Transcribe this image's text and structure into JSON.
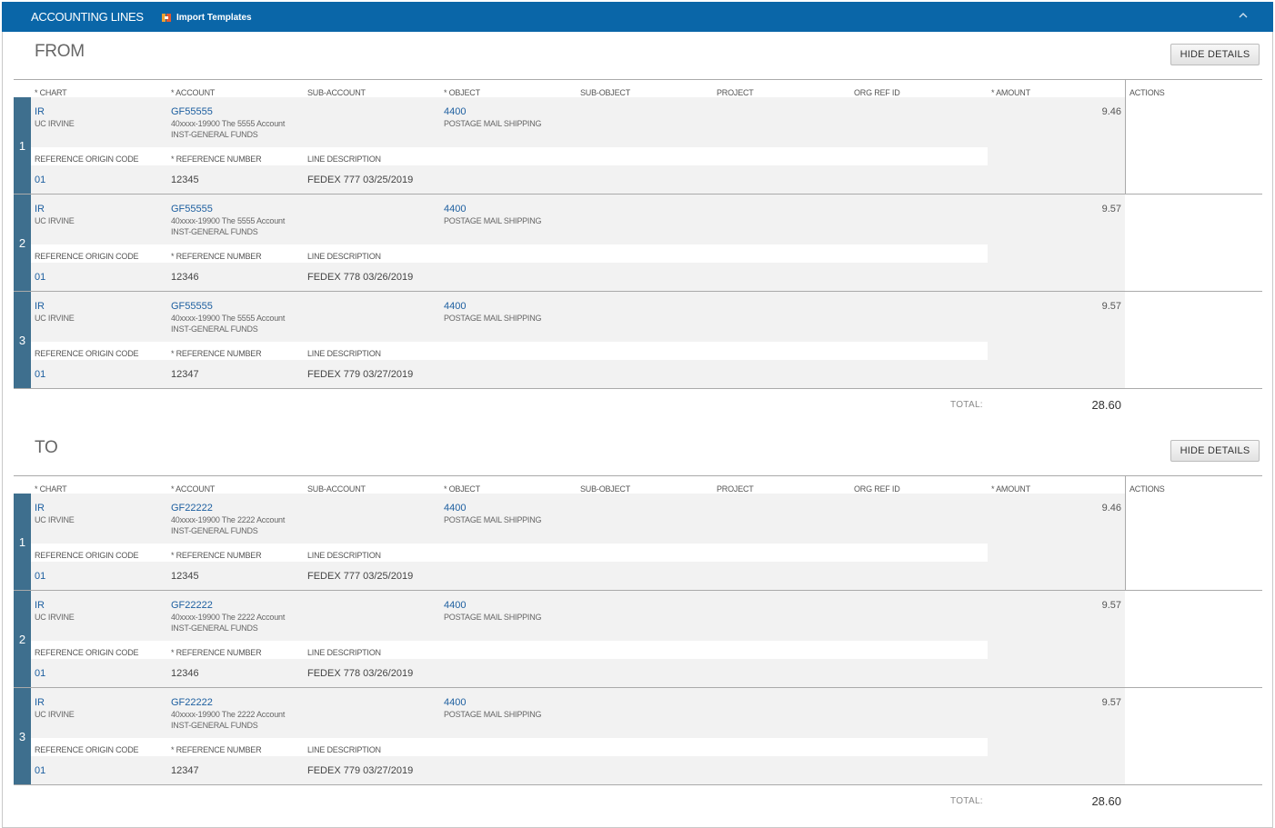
{
  "header": {
    "title": "ACCOUNTING LINES",
    "import_label": "Import Templates",
    "collapse_icon": "chevron-up-icon"
  },
  "columns": {
    "chart": "* CHART",
    "account": "* ACCOUNT",
    "sub_account": "SUB-ACCOUNT",
    "object": "* OBJECT",
    "sub_object": "SUB-OBJECT",
    "project": "PROJECT",
    "org_ref_id": "ORG REF ID",
    "amount": "* AMOUNT",
    "actions": "ACTIONS",
    "ref_origin_code": "REFERENCE ORIGIN CODE",
    "ref_number": "* REFERENCE NUMBER",
    "line_description": "LINE DESCRIPTION"
  },
  "from": {
    "title": "FROM",
    "hide_label": "HIDE DETAILS",
    "total_label": "TOTAL:",
    "total": "28.60",
    "lines": [
      {
        "num": "1",
        "chart": "IR",
        "chart_name": "UC IRVINE",
        "account": "GF55555",
        "account_desc": "40xxxx-19900 The 5555 Account",
        "account_fund": "INST-GENERAL FUNDS",
        "object": "4400",
        "object_desc": "POSTAGE MAIL SHIPPING",
        "amount": "9.46",
        "ref_origin": "01",
        "ref_number": "12345",
        "line_desc": "FEDEX 777 03/25/2019"
      },
      {
        "num": "2",
        "chart": "IR",
        "chart_name": "UC IRVINE",
        "account": "GF55555",
        "account_desc": "40xxxx-19900 The 5555 Account",
        "account_fund": "INST-GENERAL FUNDS",
        "object": "4400",
        "object_desc": "POSTAGE MAIL SHIPPING",
        "amount": "9.57",
        "ref_origin": "01",
        "ref_number": "12346",
        "line_desc": "FEDEX 778 03/26/2019"
      },
      {
        "num": "3",
        "chart": "IR",
        "chart_name": "UC IRVINE",
        "account": "GF55555",
        "account_desc": "40xxxx-19900 The 5555 Account",
        "account_fund": "INST-GENERAL FUNDS",
        "object": "4400",
        "object_desc": "POSTAGE MAIL SHIPPING",
        "amount": "9.57",
        "ref_origin": "01",
        "ref_number": "12347",
        "line_desc": "FEDEX 779 03/27/2019"
      }
    ]
  },
  "to": {
    "title": "TO",
    "hide_label": "HIDE DETAILS",
    "total_label": "TOTAL:",
    "total": "28.60",
    "lines": [
      {
        "num": "1",
        "chart": "IR",
        "chart_name": "UC IRVINE",
        "account": "GF22222",
        "account_desc": "40xxxx-19900 The 2222 Account",
        "account_fund": "INST-GENERAL FUNDS",
        "object": "4400",
        "object_desc": "POSTAGE MAIL SHIPPING",
        "amount": "9.46",
        "ref_origin": "01",
        "ref_number": "12345",
        "line_desc": "FEDEX 777 03/25/2019"
      },
      {
        "num": "2",
        "chart": "IR",
        "chart_name": "UC IRVINE",
        "account": "GF22222",
        "account_desc": "40xxxx-19900 The 2222 Account",
        "account_fund": "INST-GENERAL FUNDS",
        "object": "4400",
        "object_desc": "POSTAGE MAIL SHIPPING",
        "amount": "9.57",
        "ref_origin": "01",
        "ref_number": "12346",
        "line_desc": "FEDEX 778 03/26/2019"
      },
      {
        "num": "3",
        "chart": "IR",
        "chart_name": "UC IRVINE",
        "account": "GF22222",
        "account_desc": "40xxxx-19900 The 2222 Account",
        "account_fund": "INST-GENERAL FUNDS",
        "object": "4400",
        "object_desc": "POSTAGE MAIL SHIPPING",
        "amount": "9.57",
        "ref_origin": "01",
        "ref_number": "12347",
        "line_desc": "FEDEX 779 03/27/2019"
      }
    ]
  }
}
